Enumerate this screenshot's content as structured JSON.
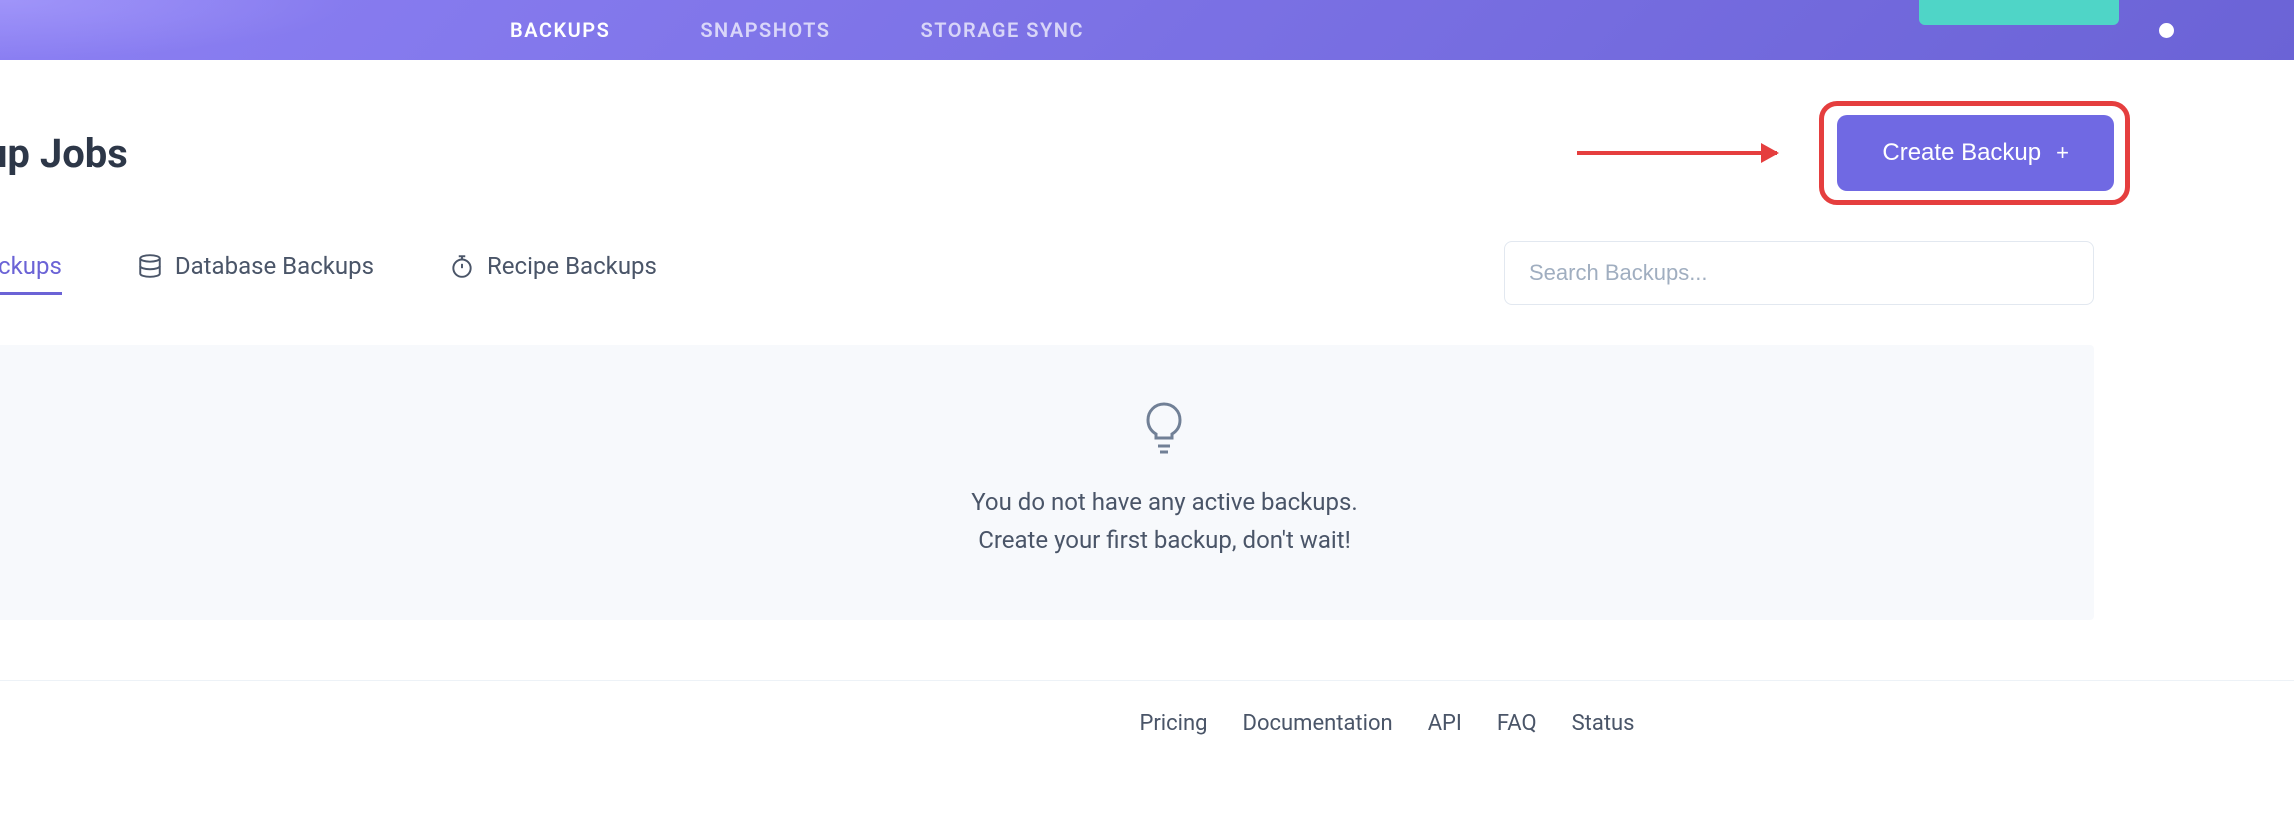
{
  "nav": {
    "items": [
      {
        "label": "BACKUPS",
        "active": true
      },
      {
        "label": "SNAPSHOTS",
        "active": false
      },
      {
        "label": "STORAGE SYNC",
        "active": false
      }
    ]
  },
  "page": {
    "title": "up Jobs"
  },
  "create_button": {
    "label": "Create Backup",
    "icon": "+"
  },
  "tabs": {
    "items": [
      {
        "label": "ackups",
        "icon": "server",
        "active": true
      },
      {
        "label": "Database Backups",
        "icon": "database",
        "active": false
      },
      {
        "label": "Recipe Backups",
        "icon": "stopwatch",
        "active": false
      }
    ]
  },
  "search": {
    "placeholder": "Search Backups..."
  },
  "empty_state": {
    "line1": "You do not have any active backups.",
    "line2": "Create your first backup, don't wait!"
  },
  "footer": {
    "links": [
      {
        "label": "Pricing"
      },
      {
        "label": "Documentation"
      },
      {
        "label": "API"
      },
      {
        "label": "FAQ"
      },
      {
        "label": "Status"
      }
    ]
  }
}
